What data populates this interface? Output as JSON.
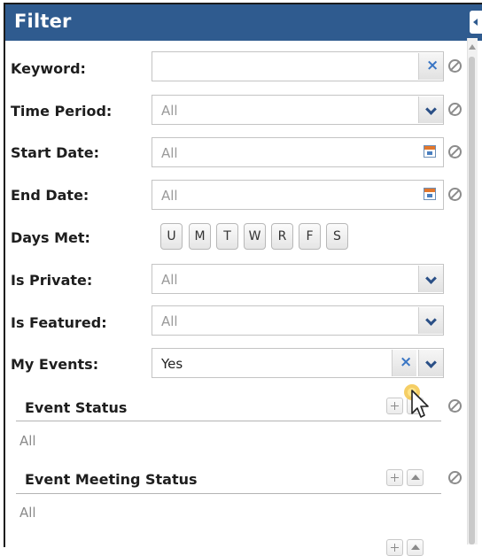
{
  "panel": {
    "title": "Filter"
  },
  "fields": [
    {
      "label": "Keyword:",
      "value": ""
    },
    {
      "label": "Time Period:",
      "value": "All"
    },
    {
      "label": "Start Date:",
      "value": "All"
    },
    {
      "label": "End Date:",
      "value": "All"
    },
    {
      "label": "Is Private:",
      "value": "All"
    },
    {
      "label": "Is Featured:",
      "value": "All"
    },
    {
      "label": "My Events:",
      "value": "Yes"
    }
  ],
  "days_met": {
    "label": "Days Met:",
    "days": [
      "U",
      "M",
      "T",
      "W",
      "R",
      "F",
      "S"
    ]
  },
  "sections": [
    {
      "title": "Event Status",
      "value": "All"
    },
    {
      "title": "Event Meeting Status",
      "value": "All"
    }
  ],
  "icons": {
    "clear": "x-icon",
    "dropdown": "chevron-down-icon",
    "calendar": "calendar-icon",
    "reset": "no-entry-icon",
    "add": "plus-icon",
    "collapse": "chevron-up-icon",
    "panel_collapse": "triangle-left-icon"
  },
  "colors": {
    "header": "#2f5b8f",
    "clear_x": "#3a76c4",
    "chevron": "#2a4f86"
  }
}
